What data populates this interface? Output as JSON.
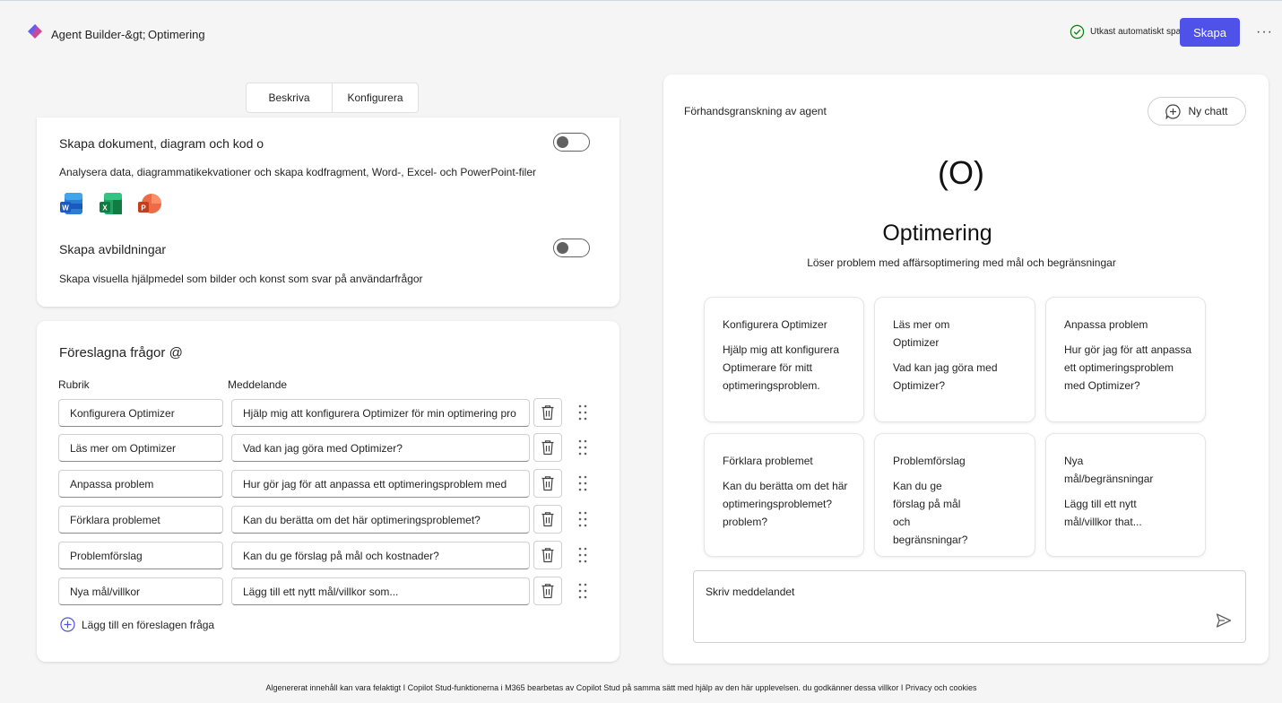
{
  "header": {
    "app_name": "Agent Builder-&gt;",
    "page_name": "Optimering",
    "saved_status": "Utkast automatiskt sparat",
    "create_label": "Skapa",
    "more_label": "···"
  },
  "tabs": [
    {
      "label": "Beskriva"
    },
    {
      "label": "Konfigurera"
    }
  ],
  "capabilities": [
    {
      "title": "Skapa dokument, diagram och kod o",
      "description": "Analysera data, diagrammatikekvationer och skapa kodfragment, Word-, Excel- och PowerPoint-filer",
      "enabled": false,
      "icons": [
        "word-icon",
        "excel-icon",
        "powerpoint-icon"
      ]
    },
    {
      "title": "Skapa avbildningar",
      "description": "Skapa visuella hjälpmedel som bilder och konst som svar på användarfrågor",
      "enabled": false
    }
  ],
  "suggested": {
    "title": "Föreslagna frågor @",
    "col_title": "Rubrik",
    "col_message": "Meddelande",
    "rows": [
      {
        "title": "Konfigurera Optimizer",
        "message": "Hjälp mig att konfigurera Optimizer för min optimering pro"
      },
      {
        "title": "Läs mer om Optimizer",
        "message": "Vad kan jag göra med Optimizer?"
      },
      {
        "title": "Anpassa problem",
        "message": "Hur gör jag för att anpassa ett optimeringsproblem med"
      },
      {
        "title": "Förklara problemet",
        "message": "Kan du berätta om det här optimeringsproblemet?"
      },
      {
        "title": "Problemförslag",
        "message": "Kan du ge förslag på mål och kostnader?"
      },
      {
        "title": "Nya mål/villkor",
        "message": "Lägg till ett nytt mål/villkor som..."
      }
    ],
    "add_label": "Lägg till en föreslagen fråga"
  },
  "preview": {
    "title": "Förhandsgranskning av agent",
    "new_chat_label": "Ny chatt",
    "avatar_text": "(O)",
    "agent_name": "Optimering",
    "agent_description": "Löser problem med affärsoptimering med mål och begränsningar",
    "starters": [
      {
        "title": "Konfigurera Optimizer",
        "body": "Hjälp mig att konfigurera Optimerare för mitt optimeringsproblem."
      },
      {
        "title": "Läs mer om Optimizer",
        "body": "Vad kan jag göra med Optimizer?"
      },
      {
        "title": "Anpassa problem",
        "body": "Hur gör jag för att anpassa ett optimeringsproblem med Optimizer?"
      },
      {
        "title": "Förklara problemet",
        "body": "Kan du berätta om det här optimeringsproblemet? problem?"
      },
      {
        "title": "Problemförslag",
        "body": "Kan du ge förslag på mål och begränsningar?"
      },
      {
        "title": "Nya mål/begränsningar",
        "body": "Lägg till ett nytt mål/villkor that..."
      }
    ],
    "input_placeholder": "Skriv meddelandet"
  },
  "footer": "Algenererat innehåll kan vara felaktigt I Copilot Stud-funktionerna i M365 bearbetas av Copilot Stud på samma sätt med hjälp av den här upplevelsen. du godkänner dessa villkor I Privacy och cookies",
  "colors": {
    "accent": "#4f52e8",
    "success": "#107c10"
  }
}
